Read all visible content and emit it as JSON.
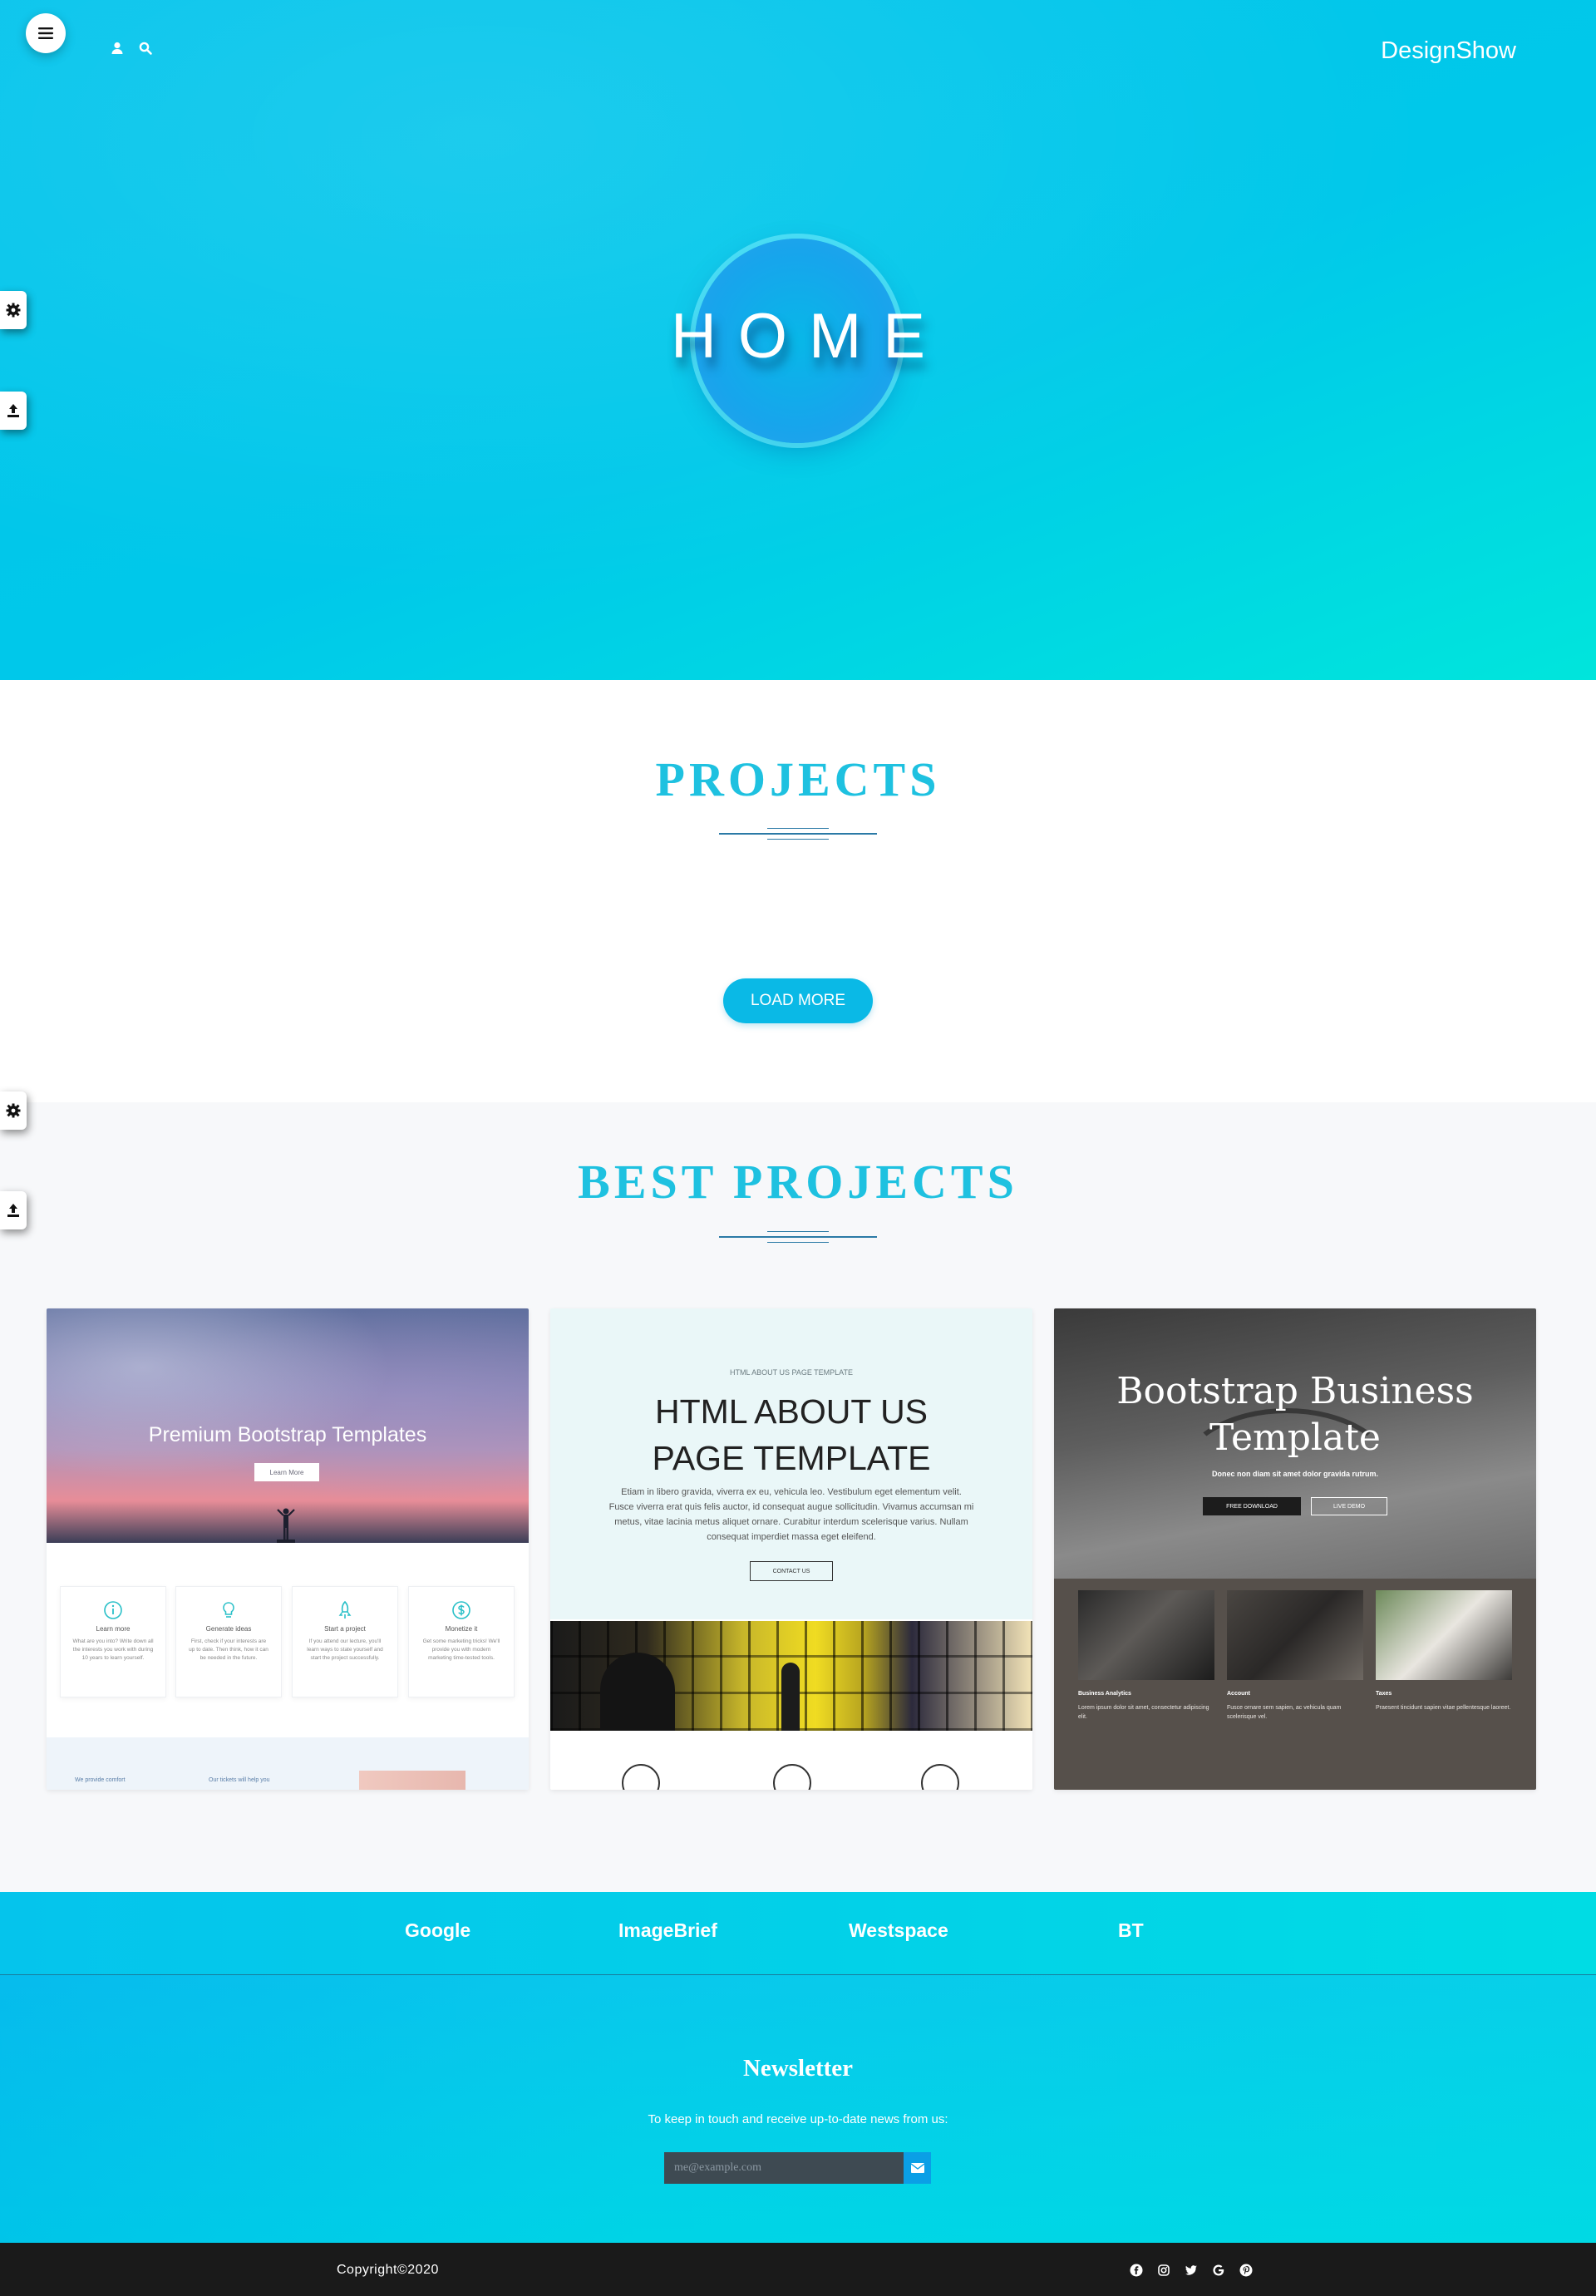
{
  "header": {
    "brand": "DesignShow",
    "hero_title": "HOME"
  },
  "projects": {
    "title": "PROJECTS",
    "load_more_label": "LOAD MORE"
  },
  "best_projects": {
    "title": "BEST PROJECTS",
    "cards": [
      {
        "title": "Premium Bootstrap Templates",
        "button": "Learn More",
        "features": [
          {
            "name": "Learn more",
            "desc": "What are you into? Write down all the interests you work with during 10 years to learn yourself."
          },
          {
            "name": "Generate ideas",
            "desc": "First, check if your interests are up to date. Then think, how it can be needed in the future."
          },
          {
            "name": "Start a project",
            "desc": "If you attend our lecture, you'll learn ways to state yourself and start the project successfully."
          },
          {
            "name": "Monetize it",
            "desc": "Get some marketing tricks! We'll provide you with modern marketing time-tested tools."
          }
        ],
        "bottom_left": "We provide comfort",
        "bottom_mid": "Our tickets will help you"
      },
      {
        "eyebrow": "HTML ABOUT US PAGE TEMPLATE",
        "title_line1": "HTML ABOUT US",
        "title_line2": "PAGE TEMPLATE",
        "body": "Etiam in libero gravida, viverra ex eu, vehicula leo. Vestibulum eget elementum velit. Fusce viverra erat quis felis auctor, id consequat augue sollicitudin. Vivamus accumsan mi metus, vitae lacinia metus aliquet ornare. Curabitur interdum scelerisque varius. Nullam consequat imperdiet massa eget eleifend.",
        "button": "CONTACT US"
      },
      {
        "title_line1": "Bootstrap Business",
        "title_line2": "Template",
        "subtitle": "Donec non diam sit amet dolor gravida rutrum.",
        "button1": "FREE DOWNLOAD",
        "button2": "LIVE DEMO",
        "columns": [
          {
            "heading": "Business Analytics",
            "text": "Lorem ipsum dolor sit amet, consectetur adipiscing elit."
          },
          {
            "heading": "Account",
            "text": "Fusce ornare sem sapien, ac vehicula quam scelerisque vel."
          },
          {
            "heading": "Taxes",
            "text": "Praesent tincidunt sapien vitae pellentesque laoreet."
          }
        ]
      }
    ]
  },
  "clients": [
    "Google",
    "ImageBrief",
    "Westspace",
    "BT"
  ],
  "newsletter": {
    "title": "Newsletter",
    "text": "To keep in touch and receive up-to-date news from us:",
    "placeholder": "me@example.com"
  },
  "footer": {
    "copyright": "Copyright©2020",
    "socials": [
      "facebook-icon",
      "instagram-icon",
      "twitter-icon",
      "google-icon",
      "pinterest-icon"
    ]
  },
  "colors": {
    "accent": "#1ec1e0",
    "hero_start": "#05c4ec",
    "hero_end": "#00e5dc",
    "footer_bg": "#1a1a1a"
  }
}
